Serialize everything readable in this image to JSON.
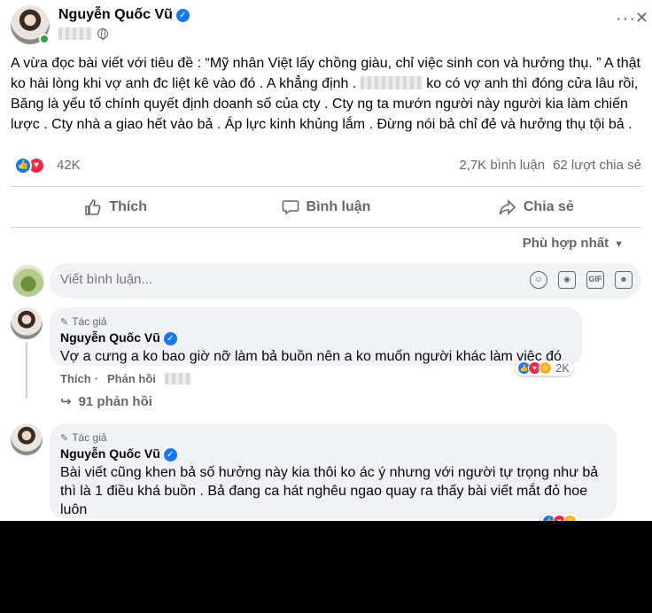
{
  "post": {
    "author": "Nguyễn Quốc Vũ",
    "more_label": "···",
    "close_label": "✕",
    "text_part1": "A vừa đọc bài viết với tiêu đề : “Mỹ nhân Việt lấy chồng giàu, chỉ việc sinh con và hưởng thụ. ” A thật ko hài lòng khi vợ anh đc liệt kê vào đó . A khẳng định . ",
    "text_part2": " ko có vợ anh thì đóng cửa lâu rồi, Băng là yếu tố chính quyết định doanh số của cty . Cty ng ta mướn người này người kia làm chiến lược . Cty nhà a giao hết vào bả . Áp lực kinh khủng lắm . Đừng nói bả chỉ đẻ và hưởng thụ tội bả .",
    "reaction_count": "42K",
    "comments_count": "2,7K bình luận",
    "shares_count": "62 lượt chia sẻ"
  },
  "actions": {
    "like": "Thích",
    "comment": "Bình luận",
    "share": "Chia sẻ"
  },
  "sort": {
    "label": "Phù hợp nhất"
  },
  "composer": {
    "placeholder": "Viết bình luận..."
  },
  "comments": [
    {
      "badge": "Tác giả",
      "author": "Nguyễn Quốc Vũ",
      "text": "Vợ a cưng a ko bao giờ nỡ làm bả buồn nên a ko muốn người khác làm việc đó",
      "like_label": "Thích",
      "reply_label": "Phản hồi",
      "reaction_count": "2K",
      "replies_label": "91 phản hồi"
    },
    {
      "badge": "Tác giả",
      "author": "Nguyễn Quốc Vũ",
      "text": "Bài viết cũng khen bả số hưởng này kia thôi ko ác ý nhưng với người tự trọng như bả thì là 1 điều khá buồn . Bả đang ca hát nghêu ngao quay ra thấy bài viết mắt đỏ hoe luôn"
    }
  ],
  "colors": {
    "accent": "#1877f2",
    "love": "#f0284a",
    "online": "#31a24c",
    "muted_text": "#65676b",
    "bubble_bg": "#f0f2f5"
  },
  "icons": {
    "like": "thumbs-up-icon",
    "comment": "speech-bubble-icon",
    "share": "share-arrow-icon",
    "privacy": "globe-icon"
  }
}
